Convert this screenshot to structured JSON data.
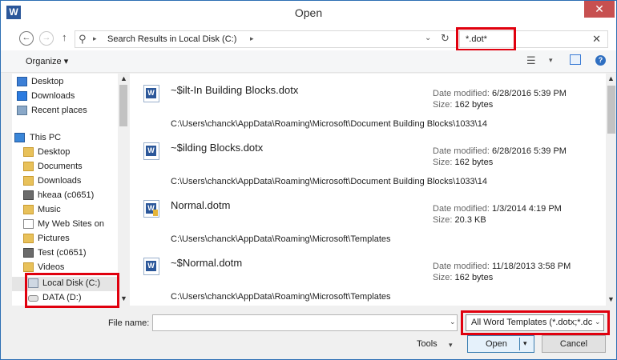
{
  "window": {
    "title": "Open",
    "app_icon_letter": "W",
    "close_glyph": "✕"
  },
  "address_bar": {
    "location": "Search Results in Local Disk (C:)",
    "search_value": "*.dot*",
    "search_clear": "✕"
  },
  "toolbar": {
    "organize_label": "Organize ▾",
    "help_glyph": "?"
  },
  "navigation": {
    "items": [
      {
        "label": "Desktop",
        "icon": "desktop-icon"
      },
      {
        "label": "Downloads",
        "icon": "downloads-icon"
      },
      {
        "label": "Recent places",
        "icon": "recent-places-icon"
      },
      {
        "label": "This PC",
        "icon": "this-pc-icon"
      },
      {
        "label": "Desktop",
        "icon": "folder-icon"
      },
      {
        "label": "Documents",
        "icon": "folder-icon"
      },
      {
        "label": "Downloads",
        "icon": "folder-icon"
      },
      {
        "label": "hkeaa (c0651)",
        "icon": "network-drive-icon"
      },
      {
        "label": "Music",
        "icon": "music-folder-icon"
      },
      {
        "label": "My Web Sites on",
        "icon": "page-icon"
      },
      {
        "label": "Pictures",
        "icon": "folder-icon"
      },
      {
        "label": "Test (c0651)",
        "icon": "network-drive-icon"
      },
      {
        "label": "Videos",
        "icon": "folder-icon"
      },
      {
        "label": "Local Disk (C:)",
        "icon": "local-disk-icon"
      },
      {
        "label": "DATA (D:)",
        "icon": "data-drive-icon"
      }
    ]
  },
  "results": [
    {
      "name": "~$ilt-In Building Blocks.dotx",
      "date_label": "Date modified:",
      "date": "6/28/2016 5:39 PM",
      "size_label": "Size:",
      "size": "162 bytes",
      "path": "C:\\Users\\chanck\\AppData\\Roaming\\Microsoft\\Document Building Blocks\\1033\\14"
    },
    {
      "name": "~$ilding Blocks.dotx",
      "date_label": "Date modified:",
      "date": "6/28/2016 5:39 PM",
      "size_label": "Size:",
      "size": "162 bytes",
      "path": "C:\\Users\\chanck\\AppData\\Roaming\\Microsoft\\Document Building Blocks\\1033\\14"
    },
    {
      "name": "Normal.dotm",
      "date_label": "Date modified:",
      "date": "1/3/2014 4:19 PM",
      "size_label": "Size:",
      "size": "20.3 KB",
      "path": "C:\\Users\\chanck\\AppData\\Roaming\\Microsoft\\Templates"
    },
    {
      "name": "~$Normal.dotm",
      "date_label": "Date modified:",
      "date": "11/18/2013 3:58 PM",
      "size_label": "Size:",
      "size": "162 bytes",
      "path": "C:\\Users\\chanck\\AppData\\Roaming\\Microsoft\\Templates"
    }
  ],
  "bottom": {
    "filename_label": "File name:",
    "filename_value": "",
    "filetype_value": "All Word Templates (*.dotx;*.dc",
    "tools_label": "Tools",
    "open_label": "Open",
    "cancel_label": "Cancel"
  },
  "colors": {
    "highlight": "#e0000e",
    "word_blue": "#2b579a",
    "close_red": "#c75050"
  }
}
